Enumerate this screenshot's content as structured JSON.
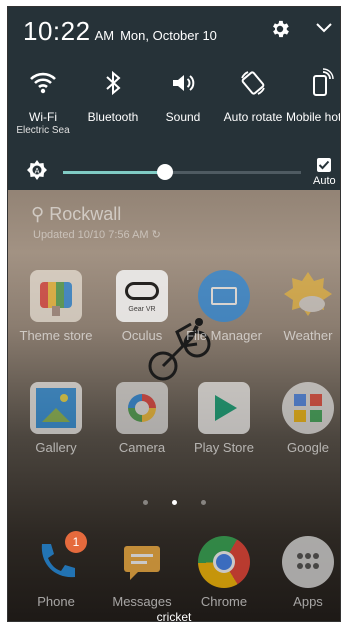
{
  "status": {
    "time": "10:22",
    "ampm": "AM",
    "date": "Mon, October 10"
  },
  "tiles": [
    {
      "icon": "wifi-icon",
      "label": "Wi-Fi",
      "sub": "Electric Sea"
    },
    {
      "icon": "bluetooth-icon",
      "label": "Bluetooth",
      "sub": ""
    },
    {
      "icon": "sound-icon",
      "label": "Sound",
      "sub": ""
    },
    {
      "icon": "auto-rotate-icon",
      "label": "Auto rotate",
      "sub": ""
    },
    {
      "icon": "mobile-hotspot-icon",
      "label": "Mobile hotspot",
      "sub": ""
    }
  ],
  "brightness": {
    "level": 0.43,
    "auto_label": "Auto",
    "auto_checked": true,
    "accent": "#80cbc4"
  },
  "weather": {
    "location": "Rockwall",
    "updated": "Updated 10/10 7:56 AM"
  },
  "apps": [
    {
      "name": "Theme store",
      "icon": "theme-store-icon"
    },
    {
      "name": "Oculus",
      "icon": "oculus-icon",
      "icon_text": "Gear VR"
    },
    {
      "name": "File Manager",
      "icon": "file-manager-icon"
    },
    {
      "name": "Weather",
      "icon": "weather-icon"
    },
    {
      "name": "Gallery",
      "icon": "gallery-icon"
    },
    {
      "name": "Camera",
      "icon": "camera-icon"
    },
    {
      "name": "Play Store",
      "icon": "play-store-icon"
    },
    {
      "name": "Google",
      "icon": "google-folder-icon"
    }
  ],
  "dock": [
    {
      "name": "Phone",
      "icon": "phone-icon",
      "badge": "1"
    },
    {
      "name": "Messages",
      "icon": "messages-icon"
    },
    {
      "name": "Chrome",
      "icon": "chrome-icon"
    },
    {
      "name": "Apps",
      "icon": "app-drawer-icon"
    }
  ],
  "pages": {
    "count": 3,
    "current": 2
  },
  "carrier": "cricket"
}
